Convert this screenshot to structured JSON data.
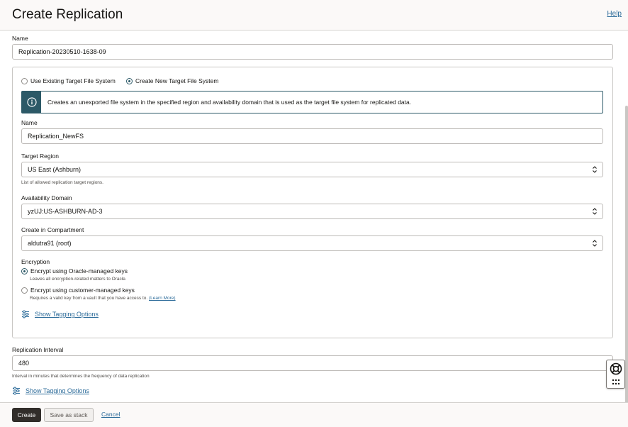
{
  "header": {
    "title": "Create Replication",
    "help_label": "Help"
  },
  "replication": {
    "name_label": "Name",
    "name_value": "Replication-20230510-1638-09"
  },
  "target": {
    "options": [
      {
        "label": "Use Existing Target File System",
        "selected": false
      },
      {
        "label": "Create New Target File System",
        "selected": true
      }
    ],
    "info_text": "Creates an unexported file system in the specified region and availability domain that is used as the target file system for replicated data.",
    "fs_name_label": "Name",
    "fs_name_value": "Replication_NewFS",
    "region_label": "Target Region",
    "region_value": "US East (Ashburn)",
    "region_hint": "List of allowed replication target regions.",
    "ad_label": "Availability Domain",
    "ad_value": "yzUJ:US-ASHBURN-AD-3",
    "compartment_label": "Create in Compartment",
    "compartment_value": "aldutra91 (root)",
    "encryption_label": "Encryption",
    "encryption_options": [
      {
        "label": "Encrypt using Oracle-managed keys",
        "hint": "Leaves all encryption-related matters to Oracle.",
        "selected": true
      },
      {
        "label": "Encrypt using customer-managed keys",
        "hint": "Requires a valid key from a vault that you have access to.",
        "link": "(Learn More)",
        "selected": false
      }
    ],
    "tagging_label": "Show Tagging Options"
  },
  "interval": {
    "label": "Replication Interval",
    "value": "480",
    "hint": "Interval in minutes that determines the frequency of data replication",
    "tagging_label": "Show Tagging Options"
  },
  "footer": {
    "create_label": "Create",
    "save_stack_label": "Save as stack",
    "cancel_label": "Cancel"
  },
  "colors": {
    "primary_button": "#312d2a",
    "link": "#2d6c9a",
    "info_accent": "#2c5967"
  }
}
